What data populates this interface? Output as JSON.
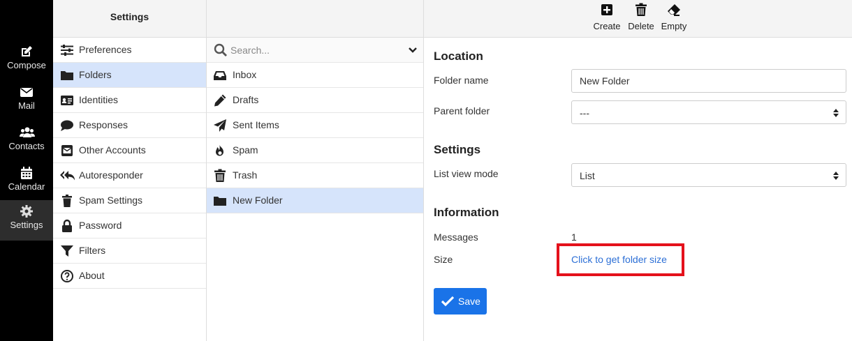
{
  "app_nav": [
    {
      "label": "Compose",
      "icon": "compose-icon"
    },
    {
      "label": "Mail",
      "icon": "envelope-icon"
    },
    {
      "label": "Contacts",
      "icon": "users-icon"
    },
    {
      "label": "Calendar",
      "icon": "calendar-icon"
    },
    {
      "label": "Settings",
      "icon": "gear-icon",
      "active": true
    }
  ],
  "settings_panel": {
    "title": "Settings",
    "items": [
      {
        "label": "Preferences",
        "icon": "sliders-icon"
      },
      {
        "label": "Folders",
        "icon": "folder-icon",
        "active": true
      },
      {
        "label": "Identities",
        "icon": "id-card-icon"
      },
      {
        "label": "Responses",
        "icon": "comment-icon"
      },
      {
        "label": "Other Accounts",
        "icon": "envelope-square-icon"
      },
      {
        "label": "Autoresponder",
        "icon": "reply-all-icon"
      },
      {
        "label": "Spam Settings",
        "icon": "trash-icon"
      },
      {
        "label": "Password",
        "icon": "lock-icon"
      },
      {
        "label": "Filters",
        "icon": "filter-icon"
      },
      {
        "label": "About",
        "icon": "question-circle-icon"
      }
    ]
  },
  "folder_list": {
    "search_placeholder": "Search...",
    "items": [
      {
        "label": "Inbox",
        "icon": "inbox-icon"
      },
      {
        "label": "Drafts",
        "icon": "pencil-icon"
      },
      {
        "label": "Sent Items",
        "icon": "paper-plane-icon"
      },
      {
        "label": "Spam",
        "icon": "fire-icon"
      },
      {
        "label": "Trash",
        "icon": "trash-icon"
      },
      {
        "label": "New Folder",
        "icon": "folder-icon",
        "active": true
      }
    ]
  },
  "toolbar": {
    "create_label": "Create",
    "delete_label": "Delete",
    "empty_label": "Empty"
  },
  "form": {
    "location_title": "Location",
    "folder_name_label": "Folder name",
    "folder_name_value": "New Folder",
    "parent_folder_label": "Parent folder",
    "parent_folder_value": "---",
    "settings_title": "Settings",
    "list_view_label": "List view mode",
    "list_view_value": "List",
    "information_title": "Information",
    "messages_label": "Messages",
    "messages_value": "1",
    "size_label": "Size",
    "size_link": "Click to get folder size",
    "save_label": "Save"
  },
  "colors": {
    "accent": "#1a73e8",
    "highlight": "#e4111b",
    "selected_row": "#d6e4fb"
  }
}
